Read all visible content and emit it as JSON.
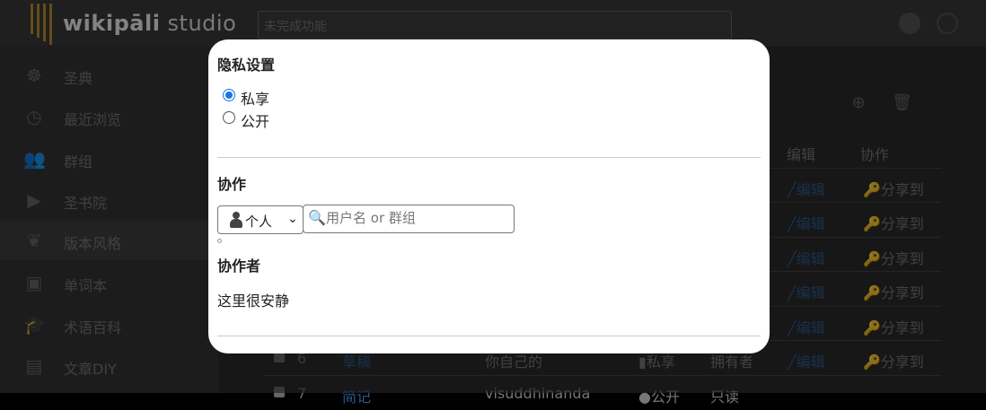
{
  "app": {
    "logo_bold": "wikipāli",
    "logo_rest": " studio",
    "top_search_placeholder": "未完成功能"
  },
  "sidebar": {
    "items": [
      {
        "label": "圣典"
      },
      {
        "label": "最近浏览"
      },
      {
        "label": "群组"
      },
      {
        "label": "圣书院"
      },
      {
        "label": "版本风格"
      },
      {
        "label": "单词本"
      },
      {
        "label": "术语百科"
      },
      {
        "label": "文章DIY"
      }
    ]
  },
  "table": {
    "headers": {
      "edit": "编辑",
      "share": "协作"
    },
    "rows": [
      {
        "edit": "编辑",
        "share": "分享到"
      },
      {
        "edit": "编辑",
        "share": "分享到"
      },
      {
        "edit": "编辑",
        "share": "分享到"
      },
      {
        "edit": "编辑",
        "share": "分享到"
      },
      {
        "edit": "编辑",
        "share": "分享到"
      },
      {
        "num": "6",
        "title": "草稿",
        "owner": "你自己的",
        "privacy": "私享",
        "role": "拥有者",
        "edit": "编辑",
        "share": "分享到"
      },
      {
        "num": "7",
        "title": "简记",
        "owner": "visuddhinanda",
        "privacy": "公开",
        "role": "只读"
      }
    ]
  },
  "modal": {
    "privacy_title": "隐私设置",
    "privacy_options": [
      {
        "label": "私享",
        "checked": true
      },
      {
        "label": "公开",
        "checked": false
      }
    ],
    "collab_title": "协作",
    "collab_type": "个人",
    "search_placeholder": "用户名 or 群组",
    "collaborators_title": "协作者",
    "empty_text": "这里很安静"
  }
}
